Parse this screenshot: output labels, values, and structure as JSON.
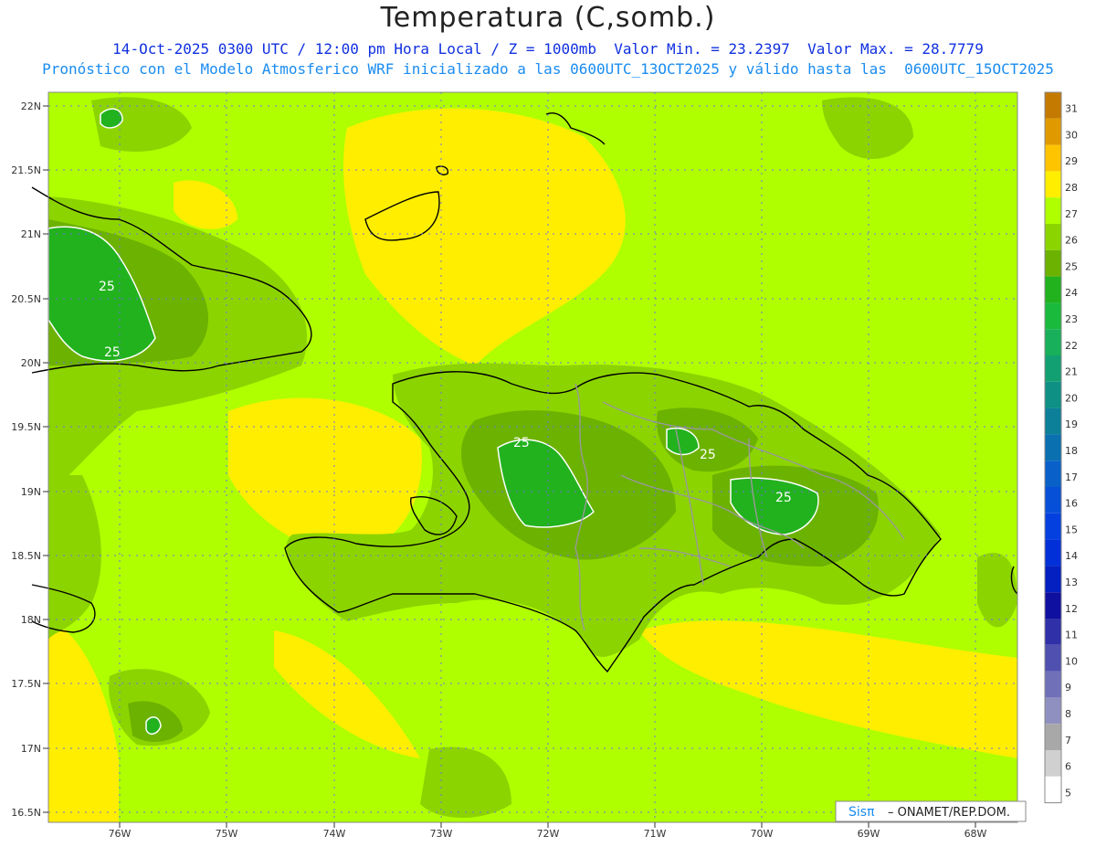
{
  "title": "Temperatura (C,somb.)",
  "subtitle_line1": "14-Oct-2025 0300 UTC / 12:00 pm Hora Local / Z = 1000mb  Valor Min. = 23.2397  Valor Max. = 28.7779",
  "subtitle_line2": "Pronóstico con el Modelo Atmosferico WRF inicializado a las 0600UTC_13OCT2025 y válido hasta las  0600UTC_15OCT2025",
  "lat_labels": [
    "22N",
    "21.5N",
    "21N",
    "20.5N",
    "20N",
    "19.5N",
    "19N",
    "18.5N",
    "18N",
    "17.5N",
    "17N",
    "16.5N"
  ],
  "lon_labels": [
    "76W",
    "75W",
    "74W",
    "73W",
    "72W",
    "71W",
    "70W",
    "69W",
    "68W"
  ],
  "contour_labels": [
    "25",
    "25",
    "25",
    "25",
    "25"
  ],
  "credit": {
    "logo": "Sisπ",
    "text": "– ONAMET/REP.DOM."
  },
  "colorbar": {
    "labels": [
      "31",
      "30",
      "29",
      "28",
      "27",
      "26",
      "25",
      "24",
      "23",
      "22",
      "21",
      "20",
      "19",
      "18",
      "17",
      "16",
      "15",
      "14",
      "13",
      "12",
      "11",
      "10",
      "9",
      "8",
      "7",
      "6",
      "5"
    ],
    "colors": [
      "#c47a00",
      "#e09a00",
      "#ffc400",
      "#ffee00",
      "#b0ff00",
      "#8cd400",
      "#6cb200",
      "#22b21e",
      "#1aba3c",
      "#18b05a",
      "#12a072",
      "#0e9085",
      "#0c8098",
      "#0a70b0",
      "#0860c8",
      "#0650d8",
      "#0440e0",
      "#0230d8",
      "#0420c0",
      "#1010a0",
      "#3030a8",
      "#5050b0",
      "#7070b8",
      "#9090c0",
      "#a8a8a8",
      "#d0d0d0",
      "#ffffff"
    ]
  },
  "colors": {
    "sea_base": "#b0ff00",
    "warm_zone": "#ffee00",
    "land_mid": "#8cd400",
    "land_cool": "#6cb200",
    "coolest": "#22b21e",
    "coast": "#000000",
    "borders": "#999999",
    "grid": "#7070e0"
  }
}
